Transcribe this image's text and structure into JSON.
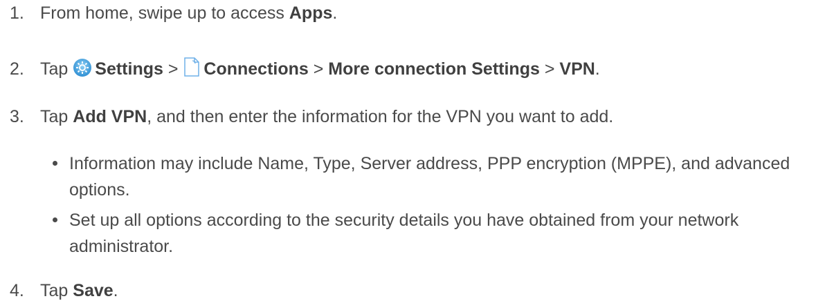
{
  "steps": [
    {
      "number": "1.",
      "text_a": "From home, swipe up to access ",
      "bold_a": "Apps",
      "text_b": "."
    },
    {
      "number": "2.",
      "text_a": "Tap ",
      "icon_settings": "settings-gear-icon",
      "bold_settings": "Settings",
      "sep1": " > ",
      "icon_connections": "connections-page-icon",
      "bold_connections": "Connections",
      "sep2": " > ",
      "bold_more": "More connection Settings",
      "sep3": " > ",
      "bold_vpn": "VPN",
      "end": "."
    },
    {
      "number": "3.",
      "text_a": "Tap ",
      "bold_a": "Add VPN",
      "text_b": ", and then enter the information for the VPN you want to add."
    },
    {
      "number": "4.",
      "text_a": "Tap ",
      "bold_a": "Save",
      "text_b": "."
    }
  ],
  "bullets": [
    "Information may include Name, Type, Server address, PPP encryption (MPPE), and advanced options.",
    "Set up all options according to the security details you have obtained from your network administrator."
  ],
  "colors": {
    "text": "#4a4a4a",
    "settings_icon": "#4aa3df",
    "connections_icon": "#5aa9e6"
  }
}
